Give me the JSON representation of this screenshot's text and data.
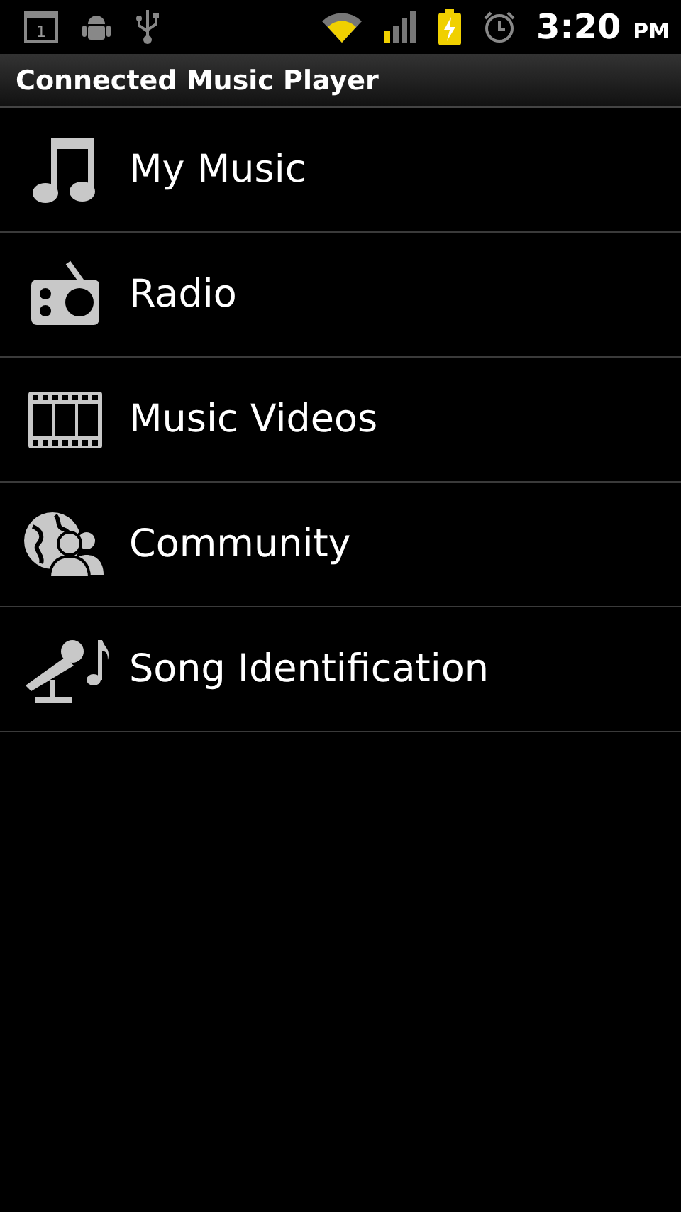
{
  "status_bar": {
    "calendar_day": "1",
    "time": "3:20",
    "meridiem": "PM"
  },
  "title_bar": {
    "title": "Connected Music Player"
  },
  "menu": {
    "items": [
      {
        "label": "My Music"
      },
      {
        "label": "Radio"
      },
      {
        "label": "Music Videos"
      },
      {
        "label": "Community"
      },
      {
        "label": "Song Identification"
      }
    ]
  }
}
